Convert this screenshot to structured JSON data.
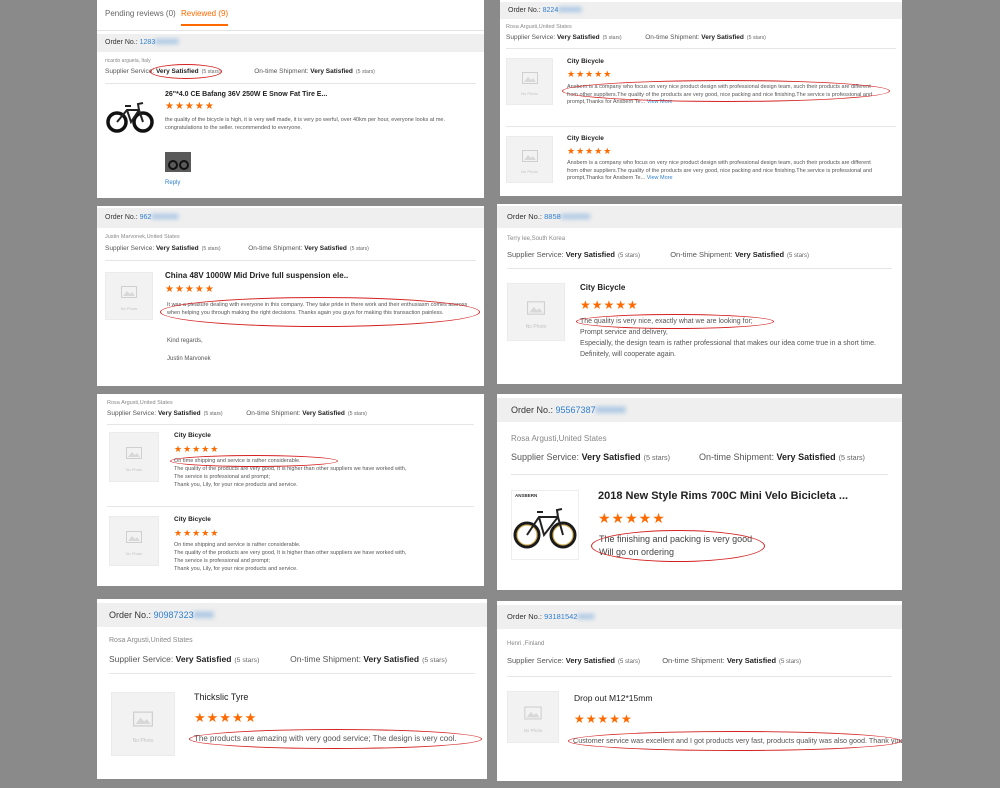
{
  "tabs": {
    "pending": "Pending reviews (0)",
    "reviewed": "Reviewed (9)"
  },
  "labels": {
    "order_no": "Order No.:",
    "supplier_service": "Supplier Service:",
    "on_time_shipment": "On-time Shipment:",
    "very_satisfied": "Very Satisfied",
    "five_stars": "(5 stars)",
    "no_photo": "No Photo",
    "reply": "Reply",
    "view_more": "View More"
  },
  "stars": "★★★★★",
  "reviews": [
    {
      "order_no": "1283",
      "author": "ricardo argueta, Italy",
      "title": "26\"*4.0 CE Bafang 36V 250W E Snow Fat Tire E...",
      "text": "the quality of the bicycle is high, it is very well made, it is very po werful, over 40km per hour, everyone looks at me.  congratulations to the seller.  recommended to everyone."
    },
    {
      "order_no": "8224",
      "author": "Rosa Argusti,United States",
      "items": [
        {
          "title": "City Bicycle",
          "text": "Ansbern is a company who focus on very nice product design with professional design team, such their products are different from other suppliers.The quality of the products are very good, nice packing and nice finishing.The service is professional and prompt,Thanks for Ansbern Te..."
        },
        {
          "title": "City Bicycle",
          "text": "Ansbern is a company who focus on very nice product design with professional design team, such their products are different from other suppliers.The quality of the products are very good, nice packing and nice finishing.The service is professional and prompt,Thanks for Ansbern Te..."
        }
      ]
    },
    {
      "order_no": "962",
      "author": "Justin Marvonek,United States",
      "title": "China 48V 1000W Mid Drive full suspension ele..",
      "text": "It was a pleasure dealing with everyone in this company. They take pride in there work and their enthusiasm comes accross when helping you through making the right decisions. Thanks again you guys for making this transaction painless.",
      "regards": "Kind regards,",
      "signature": "Justin Marvonek"
    },
    {
      "order_no": "8858",
      "author": "Terry lee,South Korea",
      "title": "City Bicycle",
      "text": "The quality is very nice, exactly what we are looking for;",
      "text2": "Prompt service and delivery,",
      "text3": "Especially, the design team is rather professional that makes our idea come true in a short time.",
      "text4": "Definitely, will cooperate again."
    },
    {
      "author": "Rosa Argusti,United States",
      "items": [
        {
          "title": "City Bicycle",
          "text": "On time shipping and service is rather considerable.",
          "text2": "The quality of the products are very good,  It is higher than other suppliers we have worked with,",
          "text3": "The service is professional and prompt;",
          "text4": "Thank you, Lily, for your nice products and service."
        },
        {
          "title": "City Bicycle",
          "text": "On time shipping and service is rather considerable.",
          "text2": "The quality of the products are very good,  It is higher than other suppliers we have worked with,",
          "text3": "The service is professional and prompt;",
          "text4": "Thank you, Lily, for your nice products and service."
        }
      ]
    },
    {
      "order_no": "95567387",
      "author": "Rosa Argusti,United States",
      "title": "2018 New Style Rims 700C Mini Velo Bicicleta ...",
      "text": "The finishing and packing is very good",
      "text2": "Will go on ordering",
      "brand": "ANSBERN"
    },
    {
      "order_no": "90987323",
      "author": "Rosa Argusti,United States",
      "title": "Thickslic Tyre",
      "text": "The products are amazing with very good service; The design is very cool."
    },
    {
      "order_no": "93181542",
      "author": "Henri ,Finland",
      "title": "Drop out M12*15mm",
      "text": "Customer service was excellent and I got products very fast, products quality was also good. Thank you!"
    }
  ],
  "colors": {
    "accent": "#ff6a00",
    "link": "#2f7fd1",
    "highlight": "#d42020",
    "backdrop": "#8a8a8a"
  }
}
